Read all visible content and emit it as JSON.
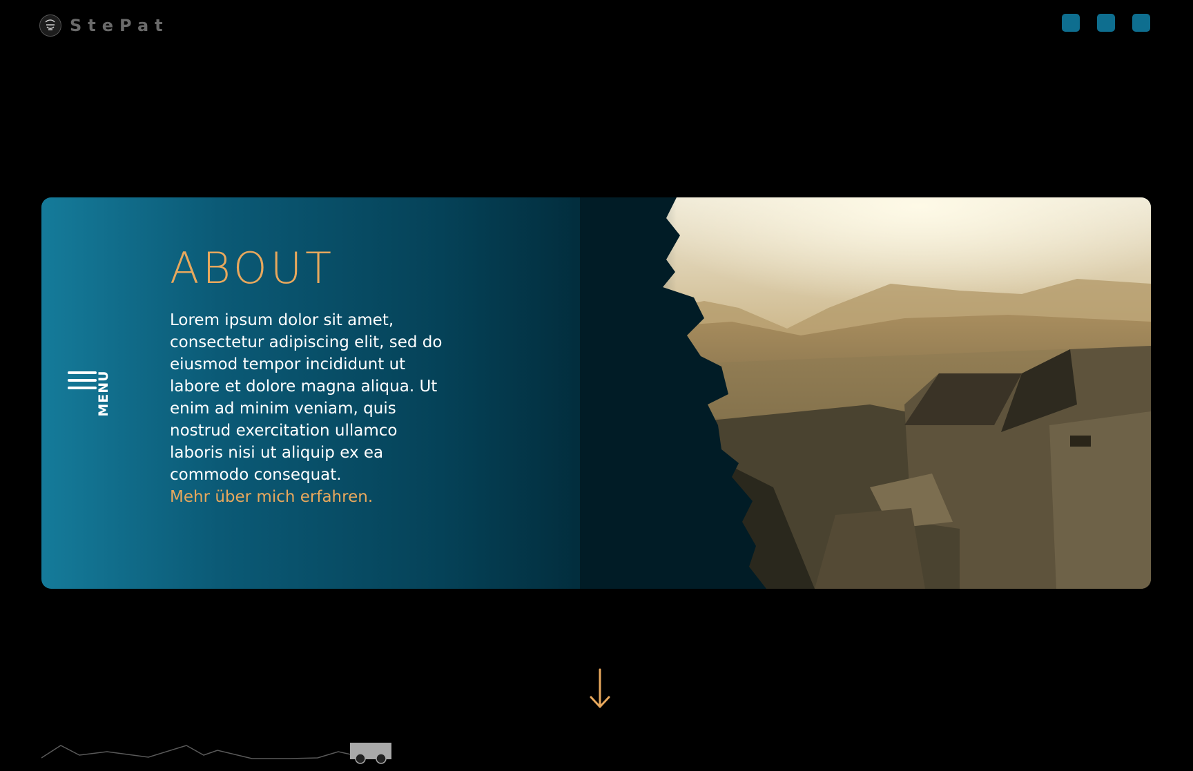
{
  "brand": {
    "name": "StePat",
    "logo_icon": "stepat-logo-icon"
  },
  "social": [
    {
      "icon": "social-icon-1",
      "color": "#0e6e8f"
    },
    {
      "icon": "social-icon-2",
      "color": "#0e6e8f"
    },
    {
      "icon": "social-icon-3",
      "color": "#0e6e8f"
    }
  ],
  "menu": {
    "label": "MENU",
    "icon": "hamburger-icon"
  },
  "about": {
    "title": "ABOUT",
    "body": "Lorem ipsum dolor sit amet, consectetur adipiscing elit, sed do eiusmod tempor incididunt ut labore et dolore magna aliqua. Ut enim ad minim veniam, quis nostrud exercitation ullamco laboris nisi ut aliquip ex ea commodo consequat.",
    "link": "Mehr über mich erfahren."
  },
  "scroll": {
    "icon": "arrow-down-icon"
  },
  "colors": {
    "accent": "#e8a85d",
    "card_start": "#157b9a",
    "card_end": "#011c26",
    "social": "#0e6e8f",
    "background": "#000000"
  }
}
